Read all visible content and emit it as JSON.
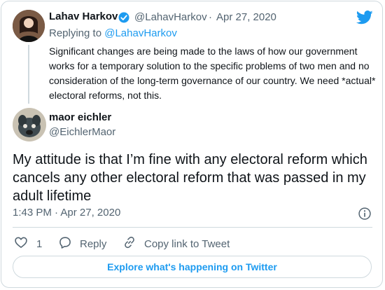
{
  "parent_tweet": {
    "display_name": "Lahav Harkov",
    "handle": "@LahavHarkov",
    "separator": "·",
    "date": "Apr 27, 2020",
    "replying_prefix": "Replying to",
    "replying_handle": "@LahavHarkov",
    "text": "Significant changes are being made to the laws of how our government works for a temporary solution to the specific problems of two men and no consideration of the long-term governance of our country. We need *actual* electoral reforms, not this."
  },
  "main_tweet": {
    "display_name": "maor eichler",
    "handle": "@EichlerMaor",
    "text": "My attitude is that I’m fine with any electoral reform which cancels any other electoral reform that was passed in my adult lifetime",
    "time": "1:43 PM",
    "separator": "·",
    "date": "Apr 27, 2020"
  },
  "actions": {
    "like_count": "1",
    "reply_label": "Reply",
    "copy_label": "Copy link to Tweet"
  },
  "footer": {
    "explore_label": "Explore what's happening on Twitter"
  },
  "icons": {
    "brand": "twitter-bird-icon",
    "verified": "verified-badge-icon",
    "info": "info-icon",
    "like": "heart-icon",
    "reply": "reply-bubble-icon",
    "copy": "link-icon"
  },
  "colors": {
    "accent": "#1d9bf0",
    "text": "#0f1419",
    "muted": "#536471",
    "border": "#cfd9de"
  }
}
